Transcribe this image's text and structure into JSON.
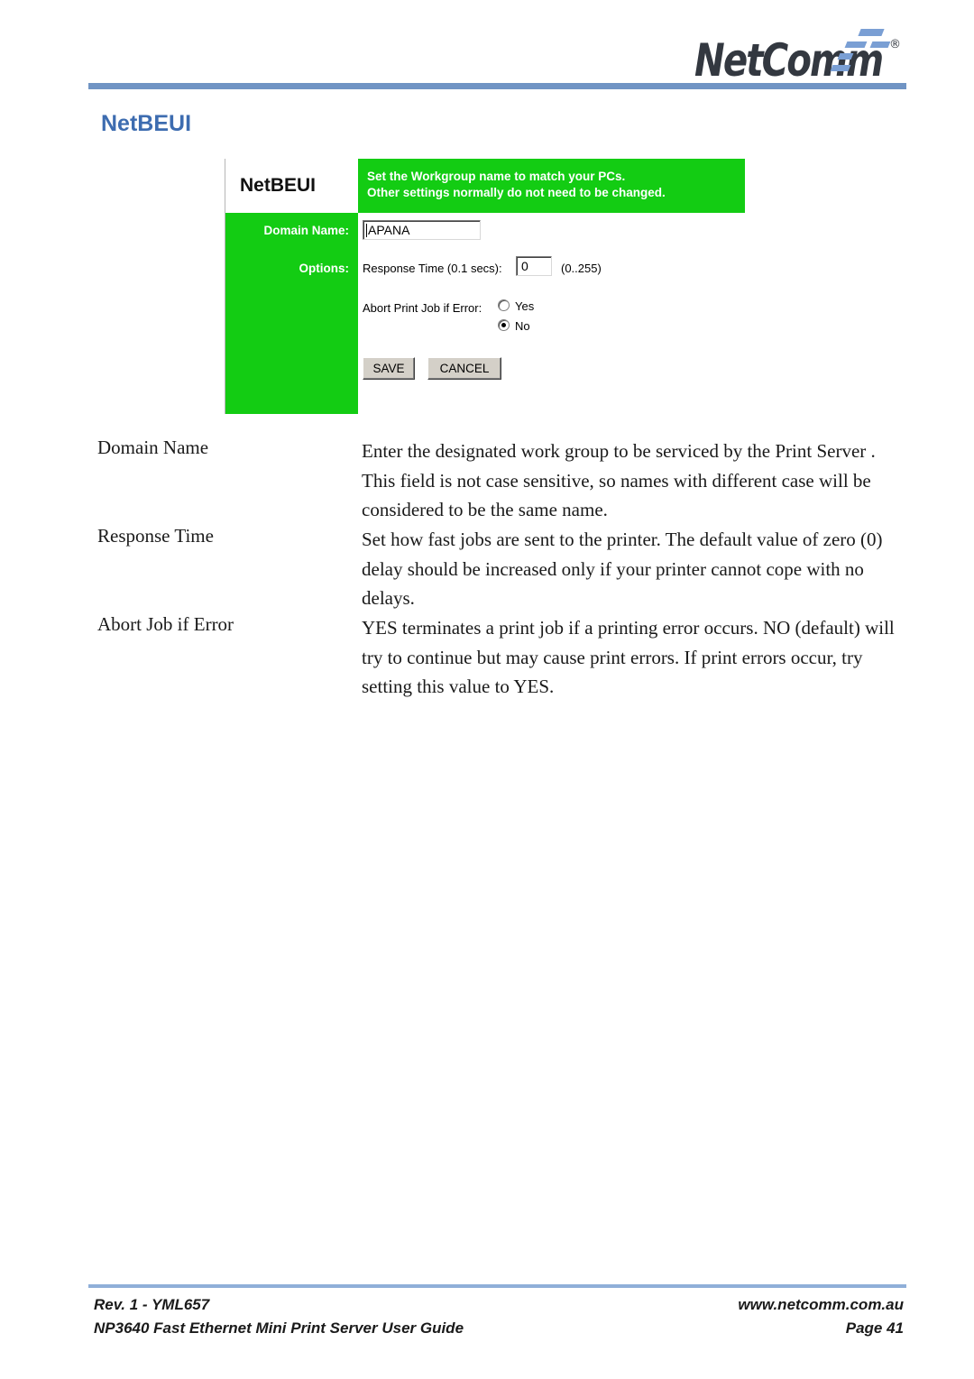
{
  "brand": {
    "wordmark": "NetComm",
    "registered_mark": "®"
  },
  "page_title": "NetBEUI",
  "config_screenshot": {
    "header": {
      "panel_title": "NetBEUI",
      "line1": "Set the Workgroup name to match your PCs.",
      "line2": "Other settings normally do not need to be changed."
    },
    "fields": {
      "domain_name_label": "Domain Name:",
      "domain_name_value": "APANA",
      "options_label": "Options:",
      "response_time_label": "Response Time (0.1 secs):",
      "response_time_value": "0",
      "response_time_range": "(0..255)",
      "abort_label": "Abort Print Job if Error:",
      "radio_yes_label": "Yes",
      "radio_no_label": "No",
      "selected_radio": "No"
    },
    "buttons": {
      "save": "SAVE",
      "cancel": "CANCEL"
    },
    "colors": {
      "panel_green": "#13cc13",
      "button_face": "#d4d0c8"
    }
  },
  "descriptions": [
    {
      "term": "Domain Name",
      "definition": "Enter the designated work group to be serviced by the Print Server . This field is not case sensitive, so names with different case will be considered to be the same name."
    },
    {
      "term": "Response Time",
      "definition": "Set how fast jobs are sent to the printer. The default value of zero (0) delay should be increased only if your printer cannot cope with no delays."
    },
    {
      "term": "Abort Job if Error",
      "definition": "YES terminates a print job if a printing error occurs. NO (default) will try to continue but may cause print errors. If print errors occur, try setting this value to YES."
    }
  ],
  "footer": {
    "revision": "Rev. 1 - YML657",
    "guide": "NP3640 Fast Ethernet Mini Print Server User Guide",
    "website": "www.netcomm.com.au",
    "page": "Page 41"
  },
  "theme": {
    "heading_blue": "#3d6cb0",
    "rule_blue": "#7094c4",
    "footer_rule_blue": "#8fafd8"
  }
}
